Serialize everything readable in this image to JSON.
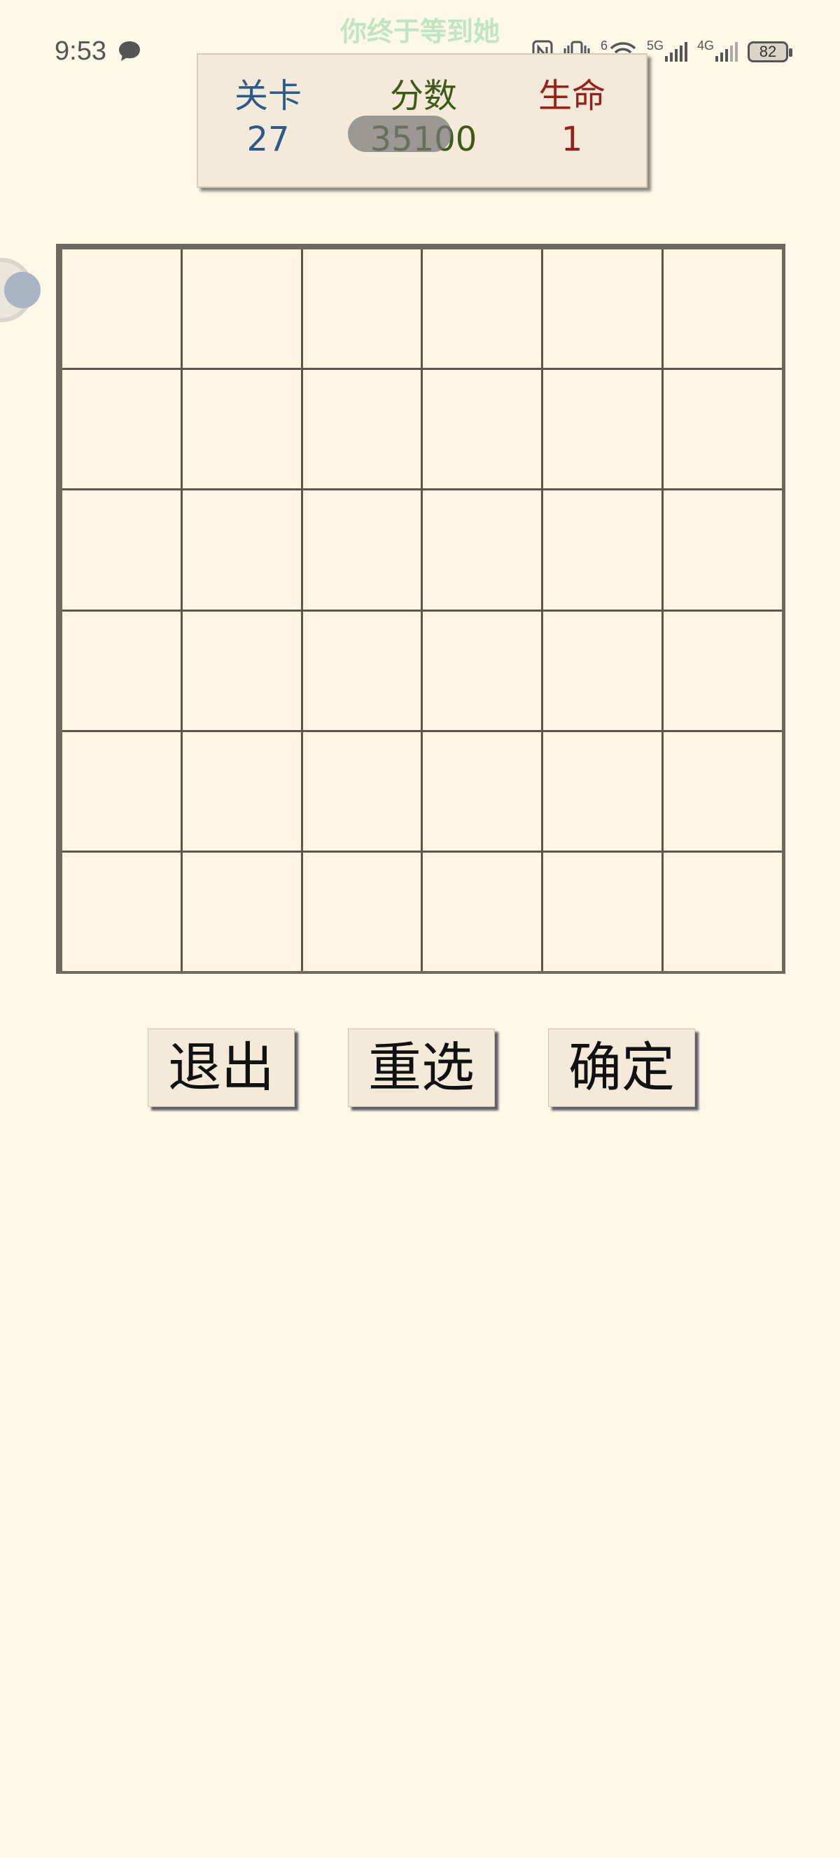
{
  "status_bar": {
    "time": "9:53",
    "signal_5g": "5G",
    "signal_4g": "4G",
    "sim_slot": "6",
    "battery": "82"
  },
  "notification": "你终于等到她",
  "panel": {
    "level": {
      "label": "关卡",
      "value": "27"
    },
    "score": {
      "label": "分数",
      "value": "35100"
    },
    "lives": {
      "label": "生命",
      "value": "1"
    }
  },
  "grid": {
    "rows": 6,
    "cols": 6
  },
  "buttons": {
    "exit": "退出",
    "reset": "重选",
    "confirm": "确定"
  },
  "colors": {
    "background": "#fdf8e8",
    "level": "#2c5a8a",
    "score": "#3e5a16",
    "lives": "#9a1f1a"
  }
}
